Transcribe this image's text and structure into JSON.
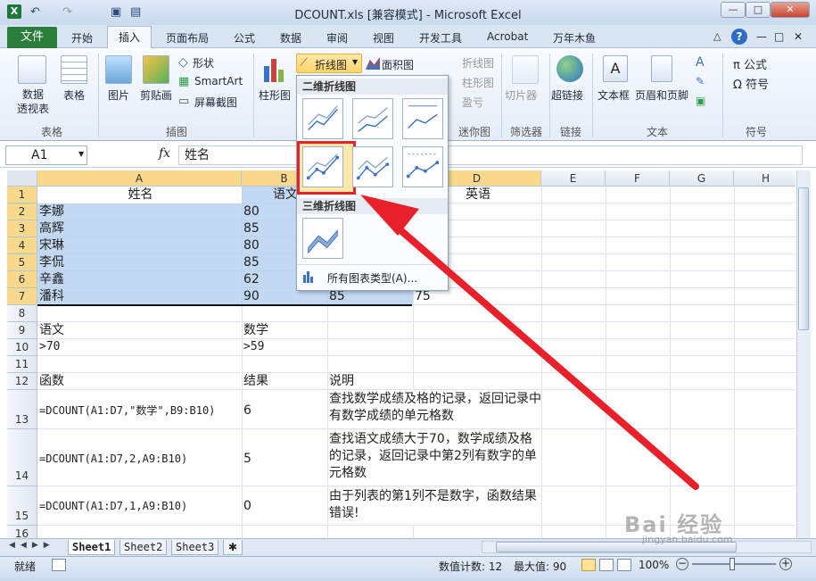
{
  "window": {
    "title": "DCOUNT.xls [兼容模式] - Microsoft Excel",
    "controls": [
      "—",
      "□",
      "✕"
    ],
    "inner_controls": [
      "△",
      "?",
      "—",
      "□",
      "✕"
    ]
  },
  "tabs": [
    "文件",
    "开始",
    "插入",
    "页面布局",
    "公式",
    "数据",
    "审阅",
    "视图",
    "开发工具",
    "Acrobat",
    "万年木鱼"
  ],
  "ribbon": {
    "table_group": {
      "label": "表格",
      "pivot": "数据\n透视表",
      "table": "表格"
    },
    "illustrations_group": {
      "label": "插图",
      "picture": "图片",
      "clipart": "剪贴画",
      "shapes": "形状",
      "smartart": "SmartArt",
      "screenshot": "屏幕截图"
    },
    "charts": {
      "column": "柱形图",
      "line": "折线图",
      "area": "面积图"
    },
    "sparklines": {
      "label": "迷你图",
      "line": "折线图",
      "column": "柱形图",
      "winloss": "盈亏"
    },
    "filter": {
      "label": "筛选器",
      "slicer": "切片器"
    },
    "links": {
      "label": "链接",
      "hyperlink": "超链接"
    },
    "text": {
      "label": "文本",
      "textbox": "文本框",
      "header": "页眉和页脚"
    },
    "symbols": {
      "label": "符号",
      "formula": "π 公式",
      "symbol": "Ω 符号"
    }
  },
  "namebox": "A1",
  "fx": "fx",
  "formula": "姓名",
  "columns": [
    "A",
    "B",
    "C",
    "D",
    "E",
    "F",
    "G",
    "H"
  ],
  "rows": [
    "1",
    "2",
    "3",
    "4",
    "5",
    "6",
    "7",
    "8",
    "9",
    "10",
    "11",
    "12",
    "13",
    "14",
    "15",
    "16"
  ],
  "cells": {
    "a1": "姓名",
    "b1": "语文",
    "d1": "英语",
    "a2": "李娜",
    "b2": "80",
    "a3": "高辉",
    "b3": "85",
    "a4": "宋琳",
    "b4": "80",
    "a5": "李侃",
    "b5": "85",
    "a6": "辛鑫",
    "b6": "62",
    "a7": "潘科",
    "b7": "90",
    "c7": "85",
    "d7": "75",
    "a9": "语文",
    "b9": "数学",
    "a10": ">70",
    "b10": ">59",
    "a12": "函数",
    "b12": "结果",
    "c12": "说明",
    "a13": "=DCOUNT(A1:D7,\"数学\",B9:B10)",
    "b13": "6",
    "c13": "查找数学成绩及格的记录，返回记录中有数学成绩的单元格数",
    "a14": "=DCOUNT(A1:D7,2,A9:B10)",
    "b14": "5",
    "c14": "查找语文成绩大于70，数学成绩及格的记录，返回记录中第2列有数字的单元格数",
    "a15": "=DCOUNT(A1:D7,1,A9:B10)",
    "b15": "0",
    "c15": "由于列表的第1列不是数字，函数结果错误!"
  },
  "dropdown": {
    "header2d": "二维折线图",
    "header3d": "三维折线图",
    "all_types": "所有图表类型(A)..."
  },
  "sheets": [
    "Sheet1",
    "Sheet2",
    "Sheet3"
  ],
  "status": {
    "ready": "就绪",
    "count": "数值计数: 12",
    "max": "最大值: 90",
    "zoom": "100%"
  },
  "watermark": {
    "brand": "Bai 经验",
    "url": "jingyan.baidu.com"
  },
  "colors": {
    "file_tab": "#2a7d3a",
    "arrow": "#e8202a",
    "selection": "#b9d1ee",
    "highlight": "#e8202a"
  }
}
